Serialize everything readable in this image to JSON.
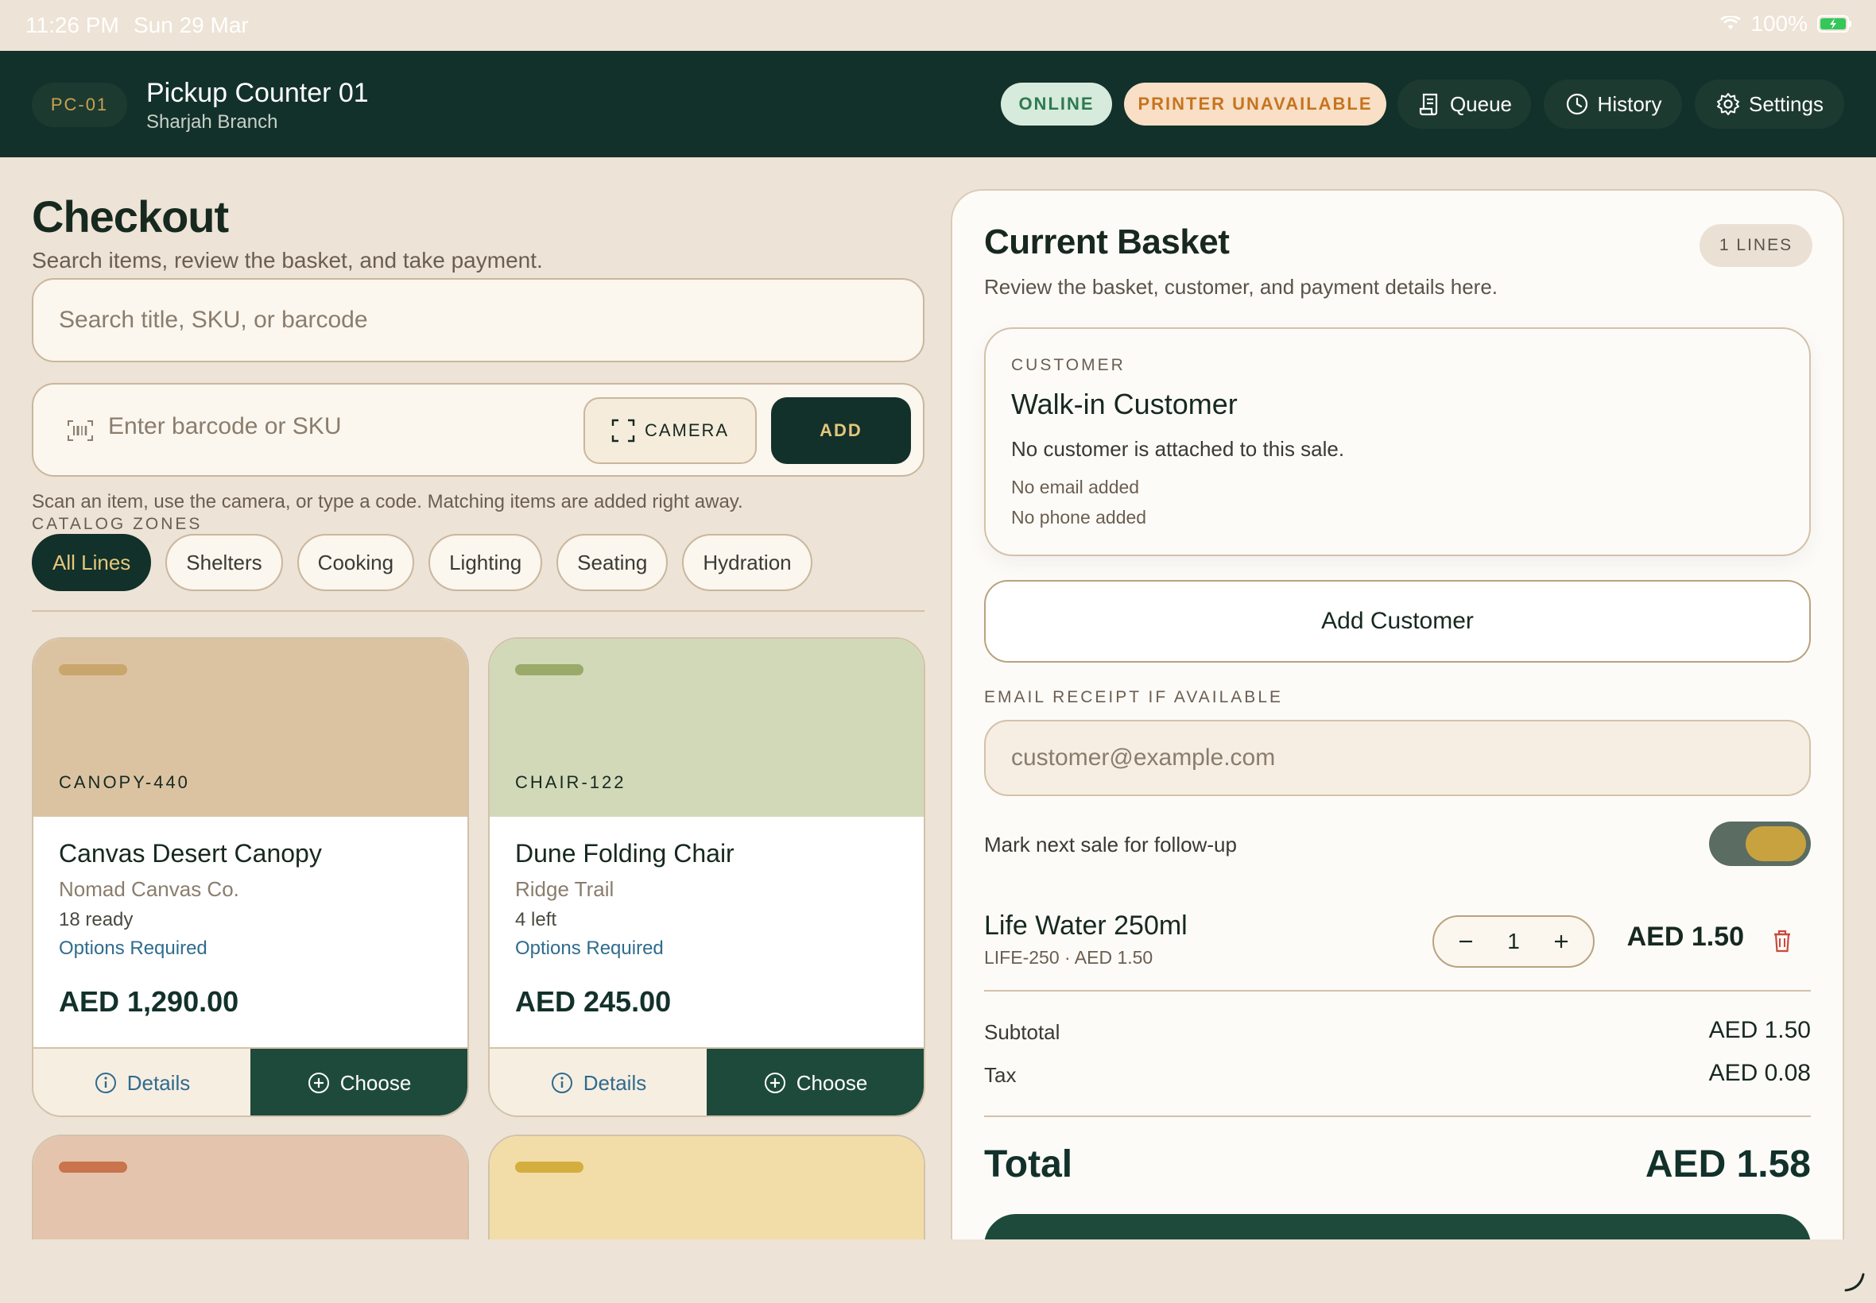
{
  "status_bar": {
    "time": "11:26 PM",
    "date": "Sun 29 Mar",
    "battery": "100%"
  },
  "header": {
    "station_code": "PC-01",
    "station_name": "Pickup Counter 01",
    "branch": "Sharjah Branch",
    "online_label": "ONLINE",
    "printer_label": "PRINTER UNAVAILABLE",
    "nav": {
      "queue": "Queue",
      "history": "History",
      "settings": "Settings"
    }
  },
  "checkout": {
    "title": "Checkout",
    "subtitle": "Search items, review the basket, and take payment.",
    "search_placeholder": "Search title, SKU, or barcode",
    "barcode_placeholder": "Enter barcode or SKU",
    "camera_label": "CAMERA",
    "add_label": "ADD",
    "hint": "Scan an item, use the camera, or type a code. Matching items are added right away.",
    "zones_label": "CATALOG ZONES",
    "zones": [
      "All Lines",
      "Shelters",
      "Cooking",
      "Lighting",
      "Seating",
      "Hydration"
    ],
    "active_zone": "All Lines"
  },
  "products": [
    {
      "sku": "CANOPY-440",
      "name": "Canvas Desert Canopy",
      "brand": "Nomad Canvas Co.",
      "stock": "18 ready",
      "options": "Options Required",
      "price": "AED 1,290.00",
      "details_label": "Details",
      "choose_label": "Choose",
      "top_color": "#DBC3A2",
      "accent_color": "#C9A66B"
    },
    {
      "sku": "CHAIR-122",
      "name": "Dune Folding Chair",
      "brand": "Ridge Trail",
      "stock": "4 left",
      "options": "Options Required",
      "price": "AED 245.00",
      "details_label": "Details",
      "choose_label": "Choose",
      "top_color": "#D2D9B9",
      "accent_color": "#9AAA68"
    },
    {
      "top_color": "#E5C4AE",
      "accent_color": "#C9744C"
    },
    {
      "top_color": "#F2DDA9",
      "accent_color": "#D4AE3E"
    }
  ],
  "basket": {
    "title": "Current Basket",
    "lines_badge": "1 LINES",
    "subtitle": "Review the basket, customer, and payment details here.",
    "customer": {
      "label": "CUSTOMER",
      "name": "Walk-in Customer",
      "note": "No customer is attached to this sale.",
      "email": "No email added",
      "phone": "No phone added"
    },
    "add_customer_label": "Add Customer",
    "email_receipt_label": "EMAIL RECEIPT IF AVAILABLE",
    "email_placeholder": "customer@example.com",
    "followup_label": "Mark next sale for follow-up",
    "followup_on": true,
    "lines": [
      {
        "name": "Life Water 250ml",
        "meta": "LIFE-250 · AED 1.50",
        "qty": "1",
        "total": "AED 1.50"
      }
    ],
    "subtotal_label": "Subtotal",
    "subtotal_value": "AED 1.50",
    "tax_label": "Tax",
    "tax_value": "AED 0.08",
    "total_label": "Total",
    "total_value": "AED 1.58"
  },
  "colors": {
    "header_bg": "#12312A",
    "accent_gold": "#E7C67C",
    "primary_green": "#1E4A3B",
    "link_blue": "#2F6C8E",
    "danger": "#C94A3A"
  }
}
